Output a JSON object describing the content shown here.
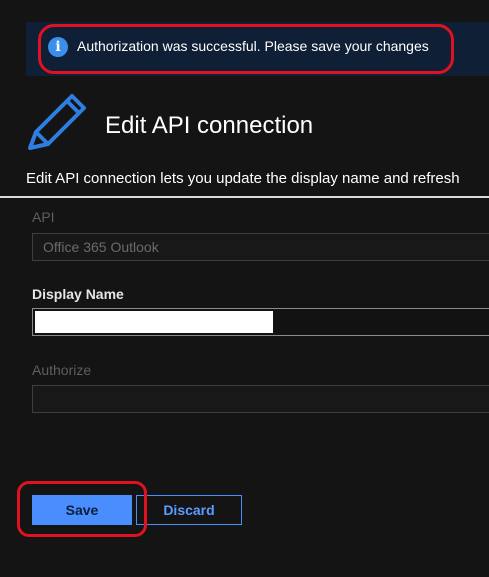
{
  "notification": {
    "icon": "info-icon",
    "icon_glyph": "i",
    "message": "Authorization was successful. Please save your changes"
  },
  "header": {
    "icon": "pencil-icon",
    "title": "Edit API connection",
    "description": "Edit API connection lets you update the display name and refresh"
  },
  "form": {
    "api": {
      "label": "API",
      "value": "Office 365 Outlook"
    },
    "display_name": {
      "label": "Display Name",
      "value": ""
    },
    "authorize": {
      "label": "Authorize",
      "value": ""
    }
  },
  "actions": {
    "save_label": "Save",
    "discard_label": "Discard"
  },
  "colors": {
    "accent": "#4a8dfc",
    "highlight_ring": "#e0121f",
    "banner_bg": "#0e1f36"
  }
}
